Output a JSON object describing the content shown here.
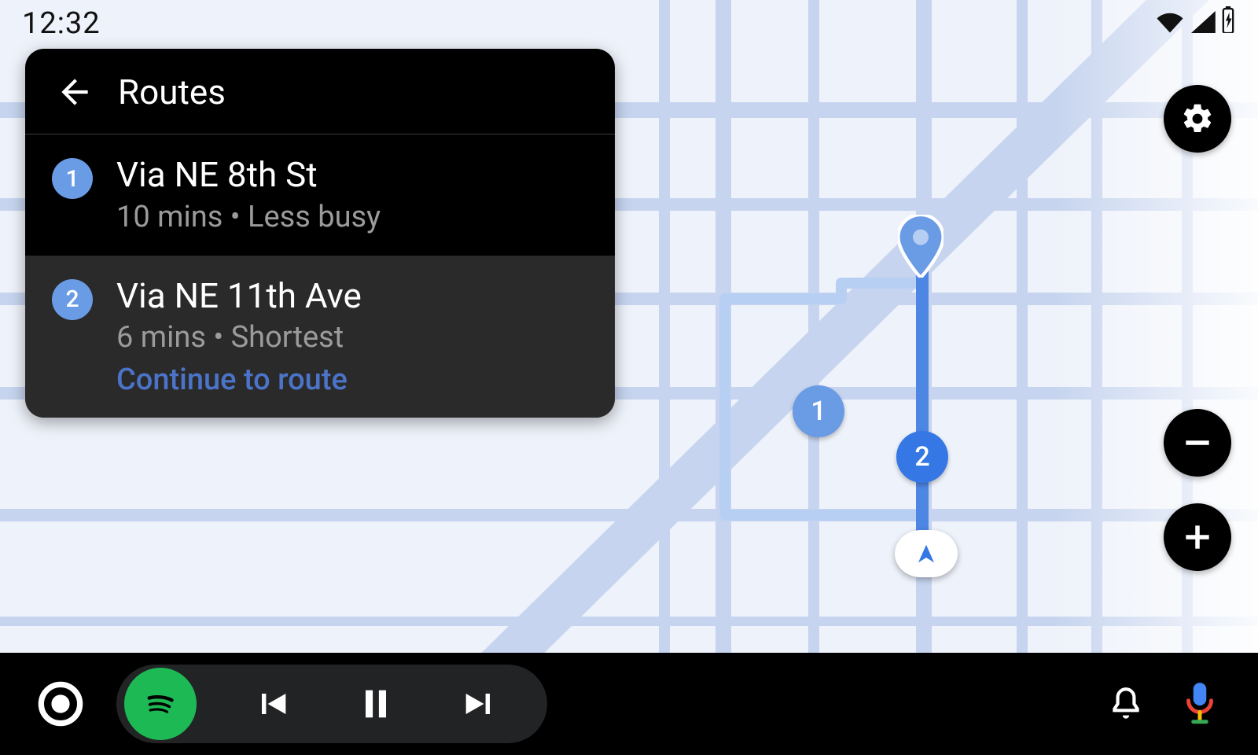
{
  "status": {
    "time": "12:32"
  },
  "panel": {
    "title": "Routes",
    "routes": [
      {
        "num": "1",
        "title": "Via NE 8th St",
        "subtitle": "10 mins • Less busy",
        "continue": ""
      },
      {
        "num": "2",
        "title": "Via NE 11th Ave",
        "subtitle": "6 mins • Shortest",
        "continue": "Continue to route"
      }
    ]
  },
  "map": {
    "markers": {
      "m1": "1",
      "m2": "2"
    }
  },
  "icons": {
    "back": "back-arrow-icon",
    "settings": "gear-icon",
    "zoom_out": "minus-icon",
    "zoom_in": "plus-icon",
    "launcher": "launcher-icon",
    "spotify": "spotify-icon",
    "prev": "prev-track-icon",
    "pause": "pause-icon",
    "next": "next-track-icon",
    "bell": "bell-icon",
    "mic": "mic-icon",
    "wifi": "wifi-icon",
    "cell": "cell-signal-icon",
    "battery": "battery-charging-icon",
    "pin": "destination-pin-icon",
    "heading": "heading-arrow-icon"
  },
  "colors": {
    "accent_blue": "#3578E5",
    "marker_blue": "#6A9BE5",
    "spotify_green": "#1DB954",
    "road": "#C6D4EF",
    "route": "#4E86E4"
  }
}
